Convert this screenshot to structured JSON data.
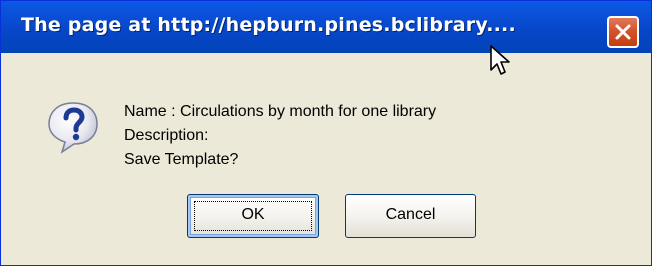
{
  "window": {
    "title": "The page at http://hepburn.pines.bclibrary....",
    "close_icon": "close-x-icon"
  },
  "message": {
    "icon": "question-icon",
    "name_line": "Name : Circulations by month for one library",
    "description_line": "Description:",
    "prompt_line": "Save Template?"
  },
  "buttons": {
    "ok_label": "OK",
    "cancel_label": "Cancel"
  },
  "colors": {
    "titlebar": "#0a50d8",
    "dialog_bg": "#ece9d8",
    "close_button": "#d5532a",
    "button_border": "#003c74"
  },
  "cursor": "arrow-cursor-icon"
}
